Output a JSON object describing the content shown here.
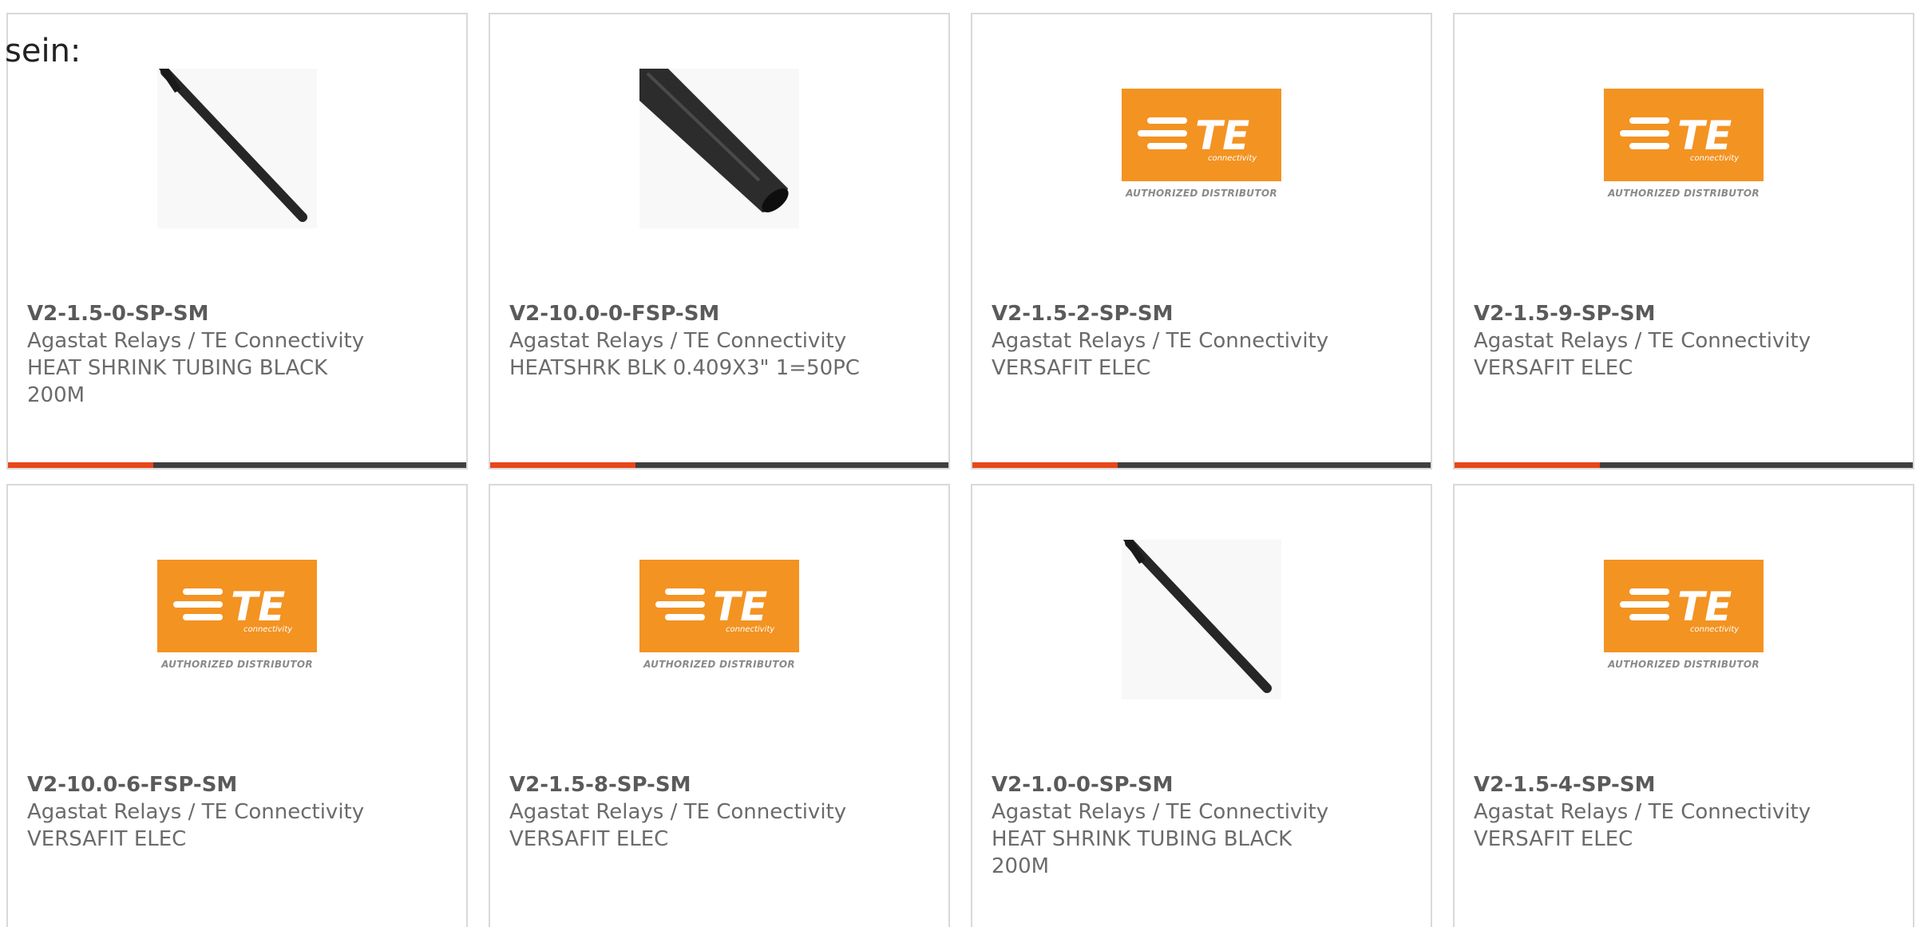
{
  "intro_text": "sein:",
  "colors": {
    "accent": "#e8461a",
    "bar": "#3f3f3f",
    "te_orange": "#f39322",
    "text": "#6b6b6b"
  },
  "logo": {
    "brand": "TE",
    "subtitle": "connectivity",
    "caption": "AUTHORIZED DISTRIBUTOR"
  },
  "products": [
    {
      "part_number": "V2-1.5-0-SP-SM",
      "manufacturer": "Agastat Relays / TE Connectivity",
      "description": "HEAT SHRINK TUBING BLACK 200M",
      "image": "thin-black-tubing"
    },
    {
      "part_number": "V2-10.0-0-FSP-SM",
      "manufacturer": "Agastat Relays / TE Connectivity",
      "description": "HEATSHRK BLK 0.409X3\" 1=50PC",
      "image": "wide-black-tubing"
    },
    {
      "part_number": "V2-1.5-2-SP-SM",
      "manufacturer": "Agastat Relays / TE Connectivity",
      "description": "VERSAFIT ELEC",
      "image": "te-logo"
    },
    {
      "part_number": "V2-1.5-9-SP-SM",
      "manufacturer": "Agastat Relays / TE Connectivity",
      "description": "VERSAFIT ELEC",
      "image": "te-logo"
    },
    {
      "part_number": "V2-10.0-6-FSP-SM",
      "manufacturer": "Agastat Relays / TE Connectivity",
      "description": "VERSAFIT ELEC",
      "image": "te-logo"
    },
    {
      "part_number": "V2-1.5-8-SP-SM",
      "manufacturer": "Agastat Relays / TE Connectivity",
      "description": "VERSAFIT ELEC",
      "image": "te-logo"
    },
    {
      "part_number": "V2-1.0-0-SP-SM",
      "manufacturer": "Agastat Relays / TE Connectivity",
      "description": "HEAT SHRINK TUBING BLACK 200M",
      "image": "thin-black-tubing"
    },
    {
      "part_number": "V2-1.5-4-SP-SM",
      "manufacturer": "Agastat Relays / TE Connectivity",
      "description": "VERSAFIT ELEC",
      "image": "te-logo"
    }
  ]
}
